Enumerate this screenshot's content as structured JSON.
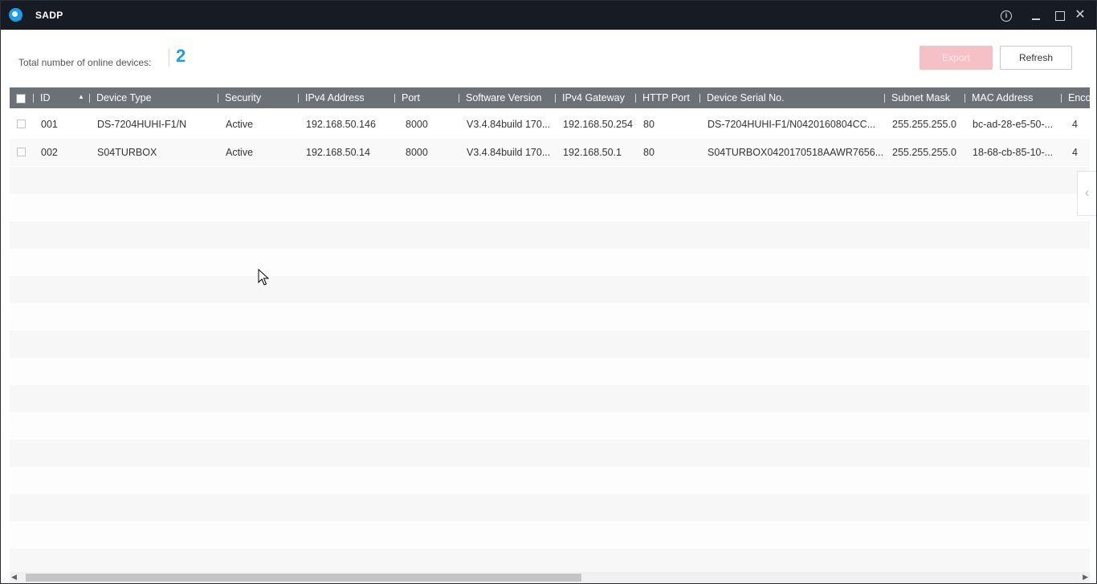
{
  "window": {
    "title": "SADP"
  },
  "summary": {
    "label": "Total number of online devices:",
    "count": "2"
  },
  "toolbar": {
    "export_label": "Export",
    "refresh_label": "Refresh"
  },
  "table": {
    "columns": [
      "ID",
      "Device Type",
      "Security",
      "IPv4 Address",
      "Port",
      "Software Version",
      "IPv4 Gateway",
      "HTTP Port",
      "Device Serial No.",
      "Subnet Mask",
      "MAC Address",
      "Enco"
    ],
    "sort": {
      "column": "ID",
      "direction": "ascending"
    },
    "rows": [
      {
        "id": "001",
        "device_type": "DS-7204HUHI-F1/N",
        "security": "Active",
        "ipv4": "192.168.50.146",
        "port": "8000",
        "software": "V3.4.84build 170...",
        "gateway": "192.168.50.254",
        "http_port": "80",
        "serial": "DS-7204HUHI-F1/N0420160804CC...",
        "subnet": "255.255.255.0",
        "mac": "bc-ad-28-e5-50-...",
        "enc": "4"
      },
      {
        "id": "002",
        "device_type": "S04TURBOX",
        "security": "Active",
        "ipv4": "192.168.50.14",
        "port": "8000",
        "software": "V3.4.84build 170...",
        "gateway": "192.168.50.1",
        "http_port": "80",
        "serial": "S04TURBOX0420170518AAWR7656...",
        "subnet": "255.255.255.0",
        "mac": "18-68-cb-85-10-...",
        "enc": "4"
      }
    ]
  },
  "icons": {
    "app": "sadp-logo-icon",
    "info": "info-icon",
    "minimize": "minimize-icon",
    "maximize": "maximize-icon",
    "close": "close-icon",
    "sort": "sort-ascending-icon",
    "collapse": "chevron-left-icon"
  },
  "colors": {
    "accent": "#1f9ce6",
    "titlebar": "#171c24",
    "header": "#6c7077",
    "export_disabled": "#f5c0c6"
  }
}
